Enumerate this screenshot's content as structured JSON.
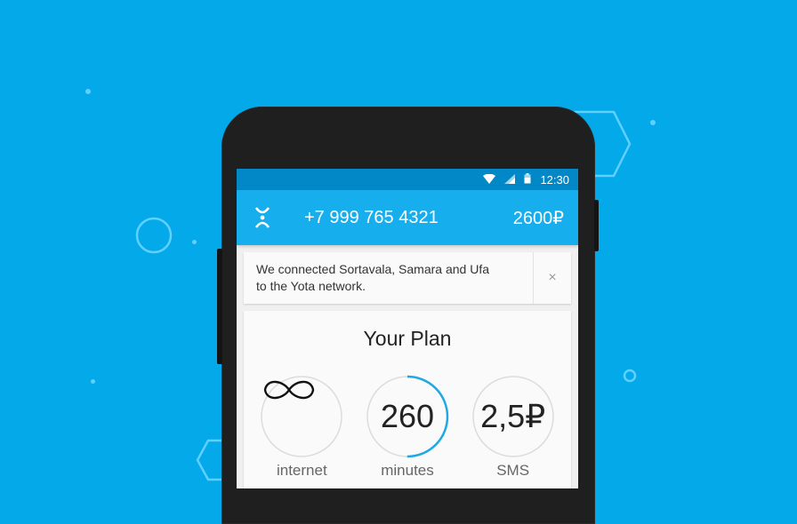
{
  "status_bar": {
    "time": "12:30"
  },
  "app_bar": {
    "logo_icon": "yota-logo-icon",
    "phone_number": "+7 999 765 4321",
    "balance": "2600₽"
  },
  "notice": {
    "message": "We connected Sortavala, Samara and Ufa\nto the Yota network.",
    "close_label": "×"
  },
  "plan": {
    "title": "Your Plan",
    "items": [
      {
        "value": "∞",
        "label": "internet",
        "icon": "infinity-icon",
        "progress": 0
      },
      {
        "value": "260",
        "label": "minutes",
        "progress": 0.5
      },
      {
        "value": "2,5₽",
        "label": "SMS",
        "progress": 0
      }
    ]
  },
  "colors": {
    "background": "#03a9e8",
    "app_bar": "#16aeec",
    "status_bar": "#0288c6",
    "progress": "#1ea9e6"
  }
}
